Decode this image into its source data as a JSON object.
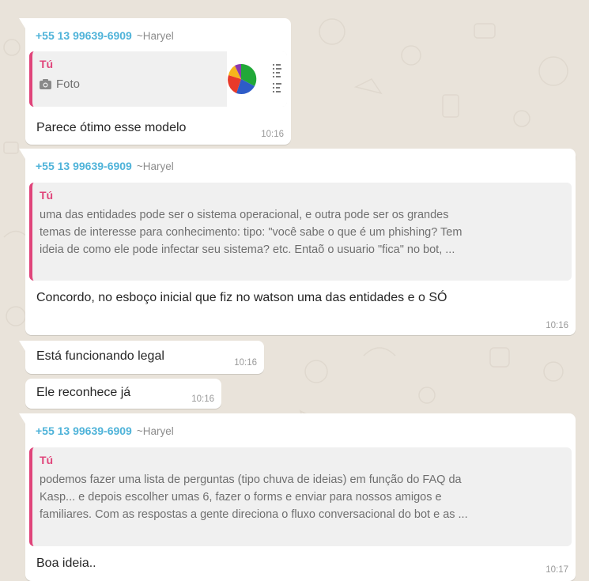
{
  "messages": [
    {
      "sender_phone": "+55 13 99639-6909",
      "sender_name": "~Haryel",
      "quote_author": "Tú",
      "quote_media_label": "Foto",
      "text": "Parece ótimo esse modelo",
      "time": "10:16"
    },
    {
      "sender_phone": "+55 13 99639-6909",
      "sender_name": "~Haryel",
      "quote_author": "Tú",
      "quote_lines": [
        "uma das entidades pode ser o sistema operacional, e outra pode ser os grandes",
        "temas de interesse para conhecimento: tipo: \"você sabe o que é um phishing? Tem",
        "ideia de como ele pode infectar seu sistema? etc. Entaõ o usuario \"fica\" no bot, ..."
      ],
      "text": "Concordo, no esboço inicial que fiz no watson uma das entidades e o SÓ",
      "time": "10:16"
    },
    {
      "text": "Está funcionando legal",
      "time": "10:16"
    },
    {
      "text": "Ele reconhece já",
      "time": "10:16"
    },
    {
      "sender_phone": "+55 13 99639-6909",
      "sender_name": "~Haryel",
      "quote_author": "Tú",
      "quote_lines": [
        "podemos fazer uma lista de perguntas (tipo chuva de ideias) em função do FAQ da",
        "Kasp... e depois escolher umas 6, fazer o forms e enviar para nossos amigos e",
        "familiares. Com as respostas a gente direciona o fluxo conversacional do bot e as ..."
      ],
      "text": "Boa ideia..",
      "time": "10:17"
    }
  ],
  "colors": {
    "background": "#e9e3da",
    "bubble": "#ffffff",
    "quote_bar": "#e0447a",
    "sender_phone": "#4fb3d9"
  }
}
